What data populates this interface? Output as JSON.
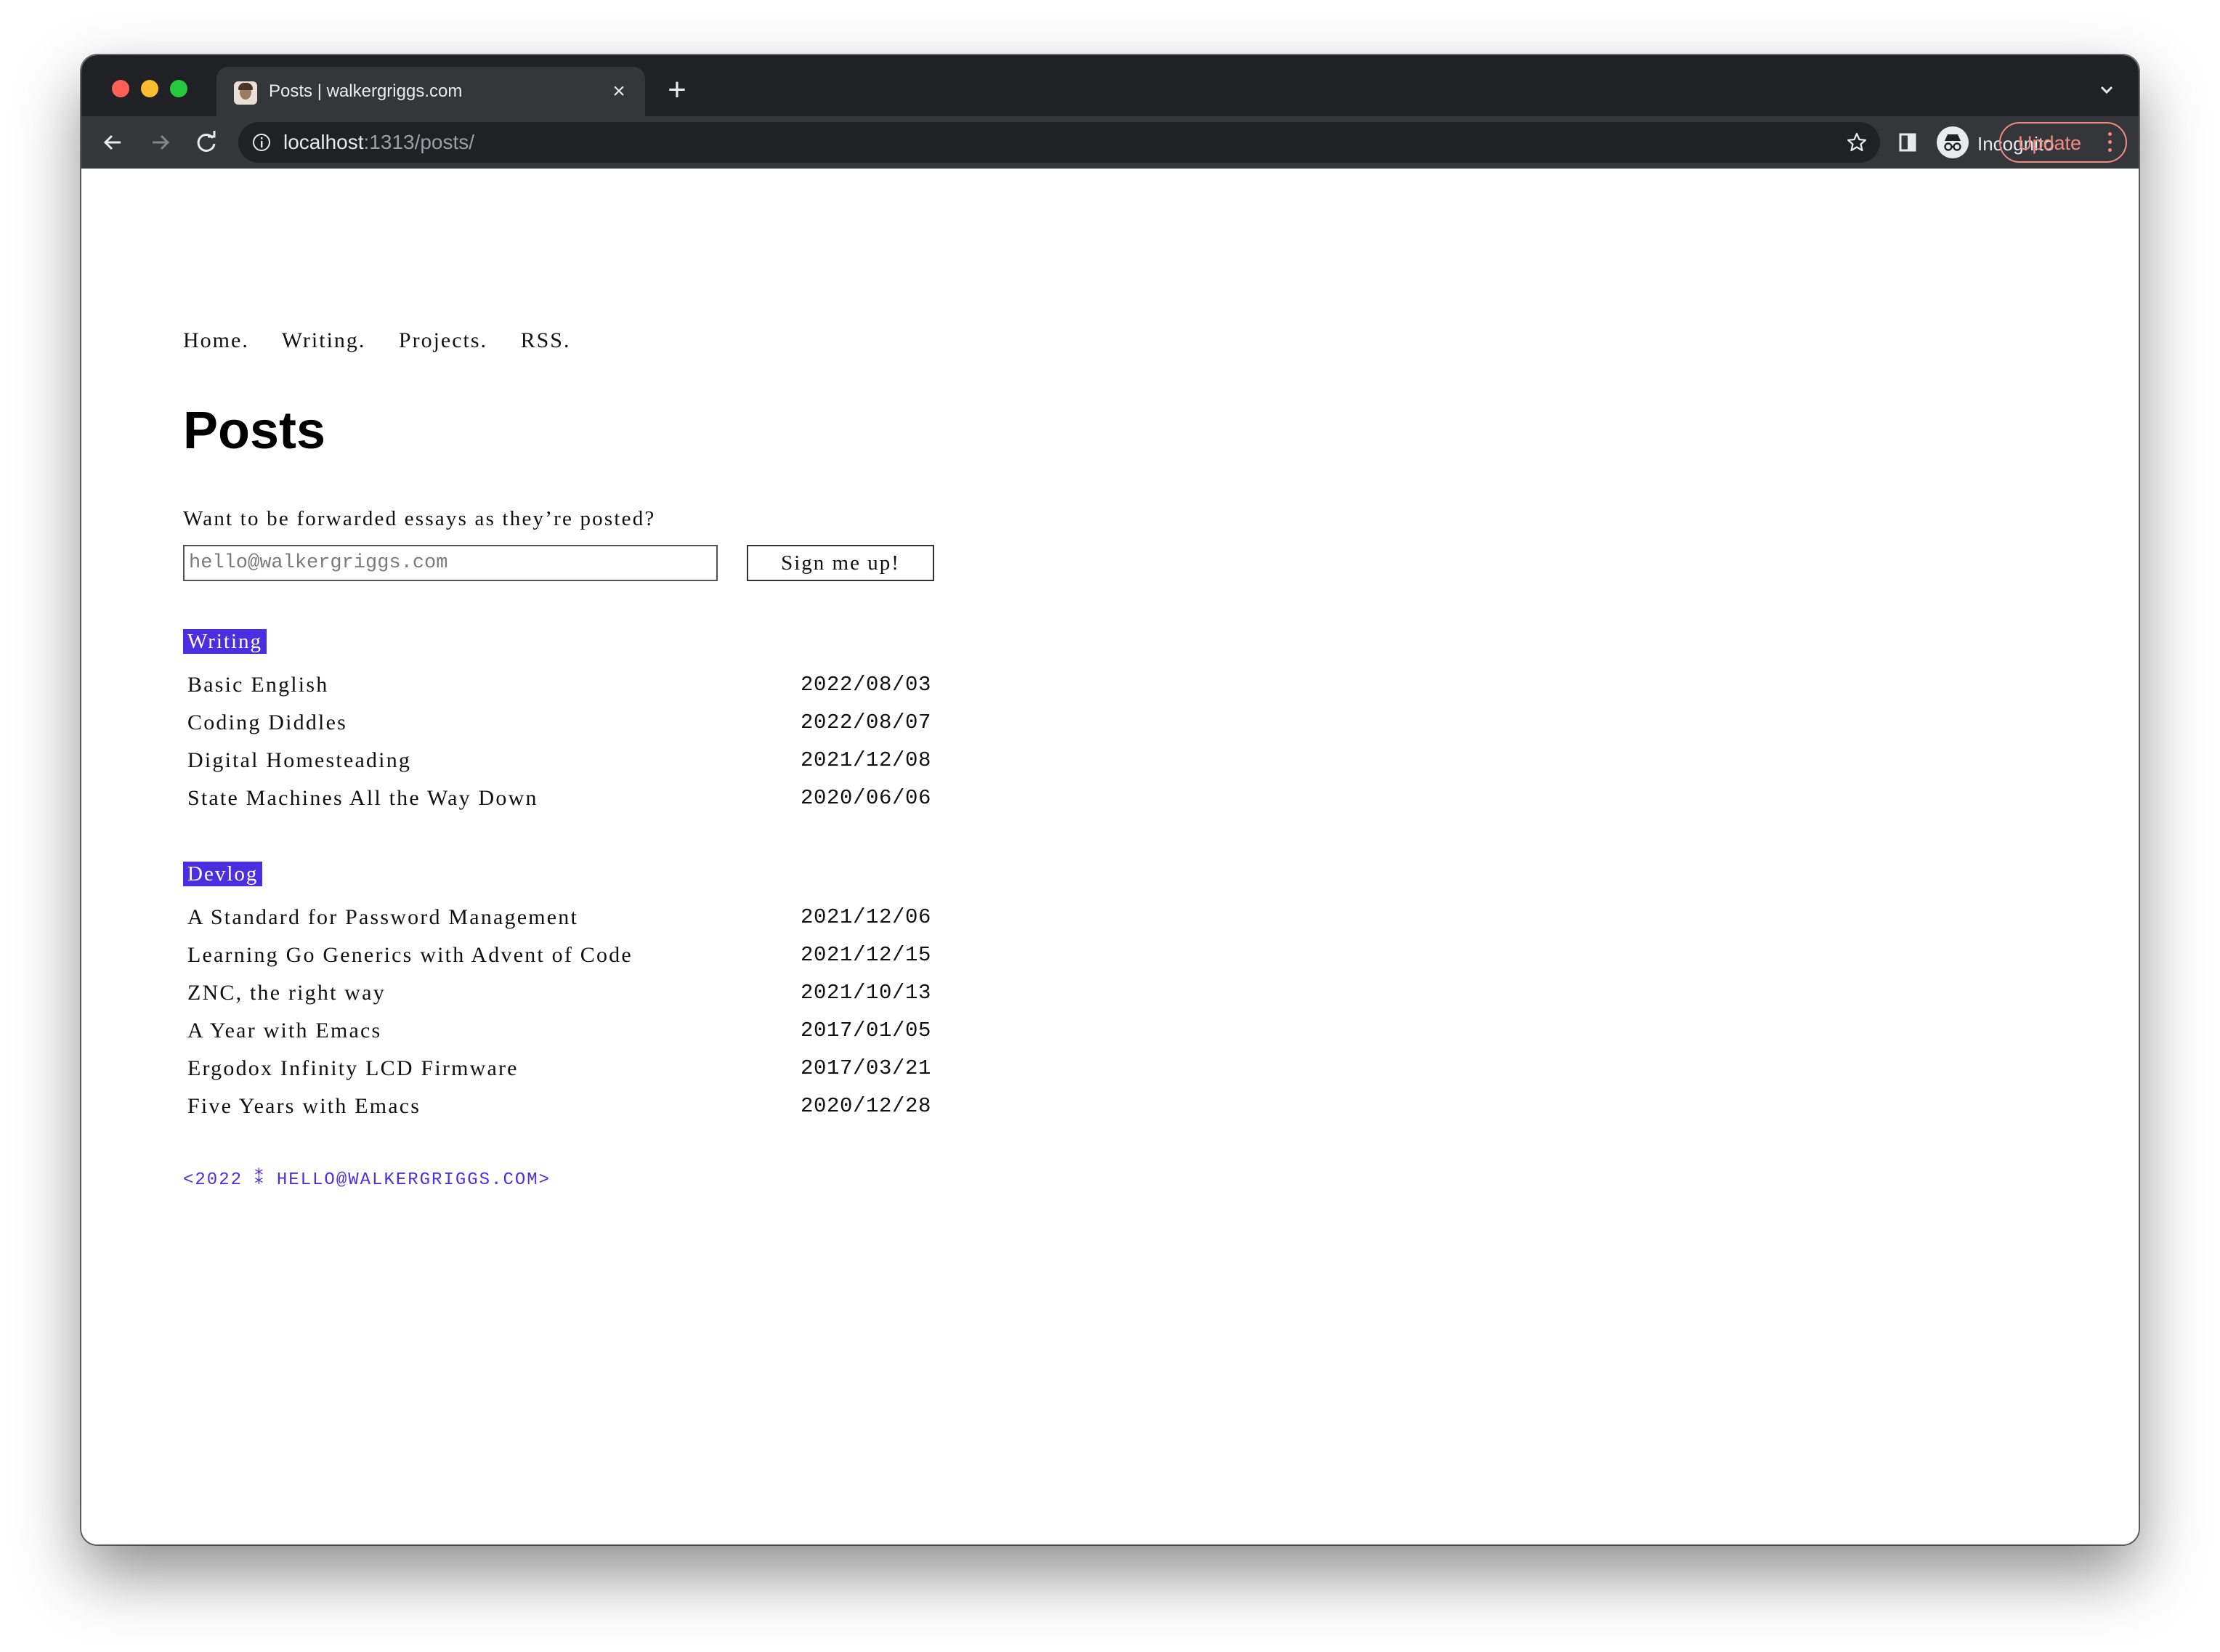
{
  "browser": {
    "tab_title": "Posts | walkergriggs.com",
    "tab_close": "×",
    "new_tab": "+",
    "url_host": "localhost",
    "url_path": ":1313/posts/",
    "incognito_label": "Incognito",
    "update_label": "Update"
  },
  "nav": {
    "items": [
      "Home.",
      "Writing.",
      "Projects.",
      "RSS."
    ]
  },
  "page": {
    "title": "Posts",
    "subscribe_prompt": "Want to be forwarded essays as they’re posted?",
    "email_placeholder": "hello@walkergriggs.com",
    "signup_label": "Sign me up!"
  },
  "sections": [
    {
      "tag": "Writing",
      "posts": [
        {
          "title": "Basic English",
          "date": "2022/08/03"
        },
        {
          "title": "Coding Diddles",
          "date": "2022/08/07"
        },
        {
          "title": "Digital Homesteading",
          "date": "2021/12/08"
        },
        {
          "title": "State Machines All the Way Down",
          "date": "2020/06/06"
        }
      ]
    },
    {
      "tag": "Devlog",
      "posts": [
        {
          "title": "A Standard for Password Management",
          "date": "2021/12/06"
        },
        {
          "title": "Learning Go Generics with Advent of Code",
          "date": "2021/12/15"
        },
        {
          "title": "ZNC, the right way",
          "date": "2021/10/13"
        },
        {
          "title": "A Year with Emacs",
          "date": "2017/01/05"
        },
        {
          "title": "Ergodox Infinity LCD Firmware",
          "date": "2017/03/21"
        },
        {
          "title": "Five Years with Emacs",
          "date": "2020/12/28"
        }
      ]
    }
  ],
  "footer": {
    "text": "<2022 ⁑ HELLO@WALKERGRIGGS.COM>"
  },
  "colors": {
    "accent": "#4b2ee0",
    "chrome_dark": "#202124",
    "chrome_toolbar": "#35363a",
    "update_accent": "#f28b82"
  }
}
